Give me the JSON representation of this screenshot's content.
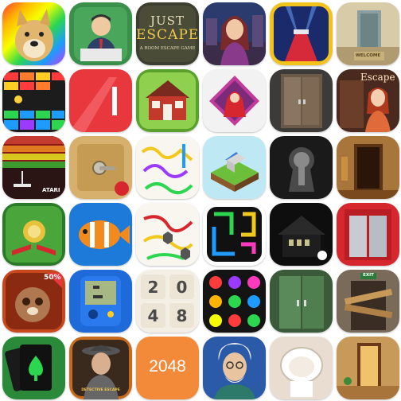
{
  "grid": {
    "rows": 6,
    "cols": 6,
    "tiles": [
      {
        "name": "doge-app-icon"
      },
      {
        "name": "office-man-app-icon"
      },
      {
        "name": "just-escape-app-icon",
        "title_line1": "JUST",
        "title_line2": "ESCAPE",
        "subtitle": "A ROOM ESCAPE GAME"
      },
      {
        "name": "girl-adventure-app-icon"
      },
      {
        "name": "red-carpet-stage-app-icon"
      },
      {
        "name": "welcome-room-app-icon",
        "mat_text": "WELCOME"
      },
      {
        "name": "brick-breaker-app-icon"
      },
      {
        "name": "red-abstract-app-icon"
      },
      {
        "name": "red-house-app-icon"
      },
      {
        "name": "red-riding-hood-app-icon"
      },
      {
        "name": "wooden-door-room-app-icon"
      },
      {
        "name": "escape-girl-app-icon",
        "title": "Escape"
      },
      {
        "name": "atari-breakout-app-icon",
        "brand": "ATARI"
      },
      {
        "name": "wooden-safe-app-icon"
      },
      {
        "name": "flow-lines-app-icon"
      },
      {
        "name": "isometric-island-app-icon"
      },
      {
        "name": "keyhole-app-icon"
      },
      {
        "name": "doorway-room-app-icon"
      },
      {
        "name": "pinball-app-icon"
      },
      {
        "name": "clownfish-app-icon"
      },
      {
        "name": "hexagon-pipes-app-icon"
      },
      {
        "name": "neon-flow-app-icon"
      },
      {
        "name": "dark-house-app-icon"
      },
      {
        "name": "elevator-app-icon"
      },
      {
        "name": "panda-warrior-app-icon",
        "badge": "50%"
      },
      {
        "name": "brick-game-app-icon"
      },
      {
        "name": "number-2048-tiles-app-icon",
        "n1": "2",
        "n2": "0",
        "n3": "4",
        "n4": "8"
      },
      {
        "name": "colored-dots-app-icon"
      },
      {
        "name": "green-door-app-icon"
      },
      {
        "name": "boarded-door-app-icon",
        "sign": "EXIT"
      },
      {
        "name": "spade-cards-app-icon"
      },
      {
        "name": "detective-app-icon",
        "caption": "DETECTIVE ESCAPE"
      },
      {
        "name": "orange-2048-app-icon",
        "number": "2048"
      },
      {
        "name": "old-professor-app-icon"
      },
      {
        "name": "toilet-app-icon"
      },
      {
        "name": "open-door-room-app-icon"
      }
    ]
  },
  "colors": {
    "background": "#ffffff",
    "rainbow": [
      "#ff3b3b",
      "#ffb400",
      "#f6ff00",
      "#2cd64f",
      "#1e9bff",
      "#9b3bff"
    ],
    "red_accent": "#e8383d",
    "orange_2048": "#f28a3a"
  }
}
